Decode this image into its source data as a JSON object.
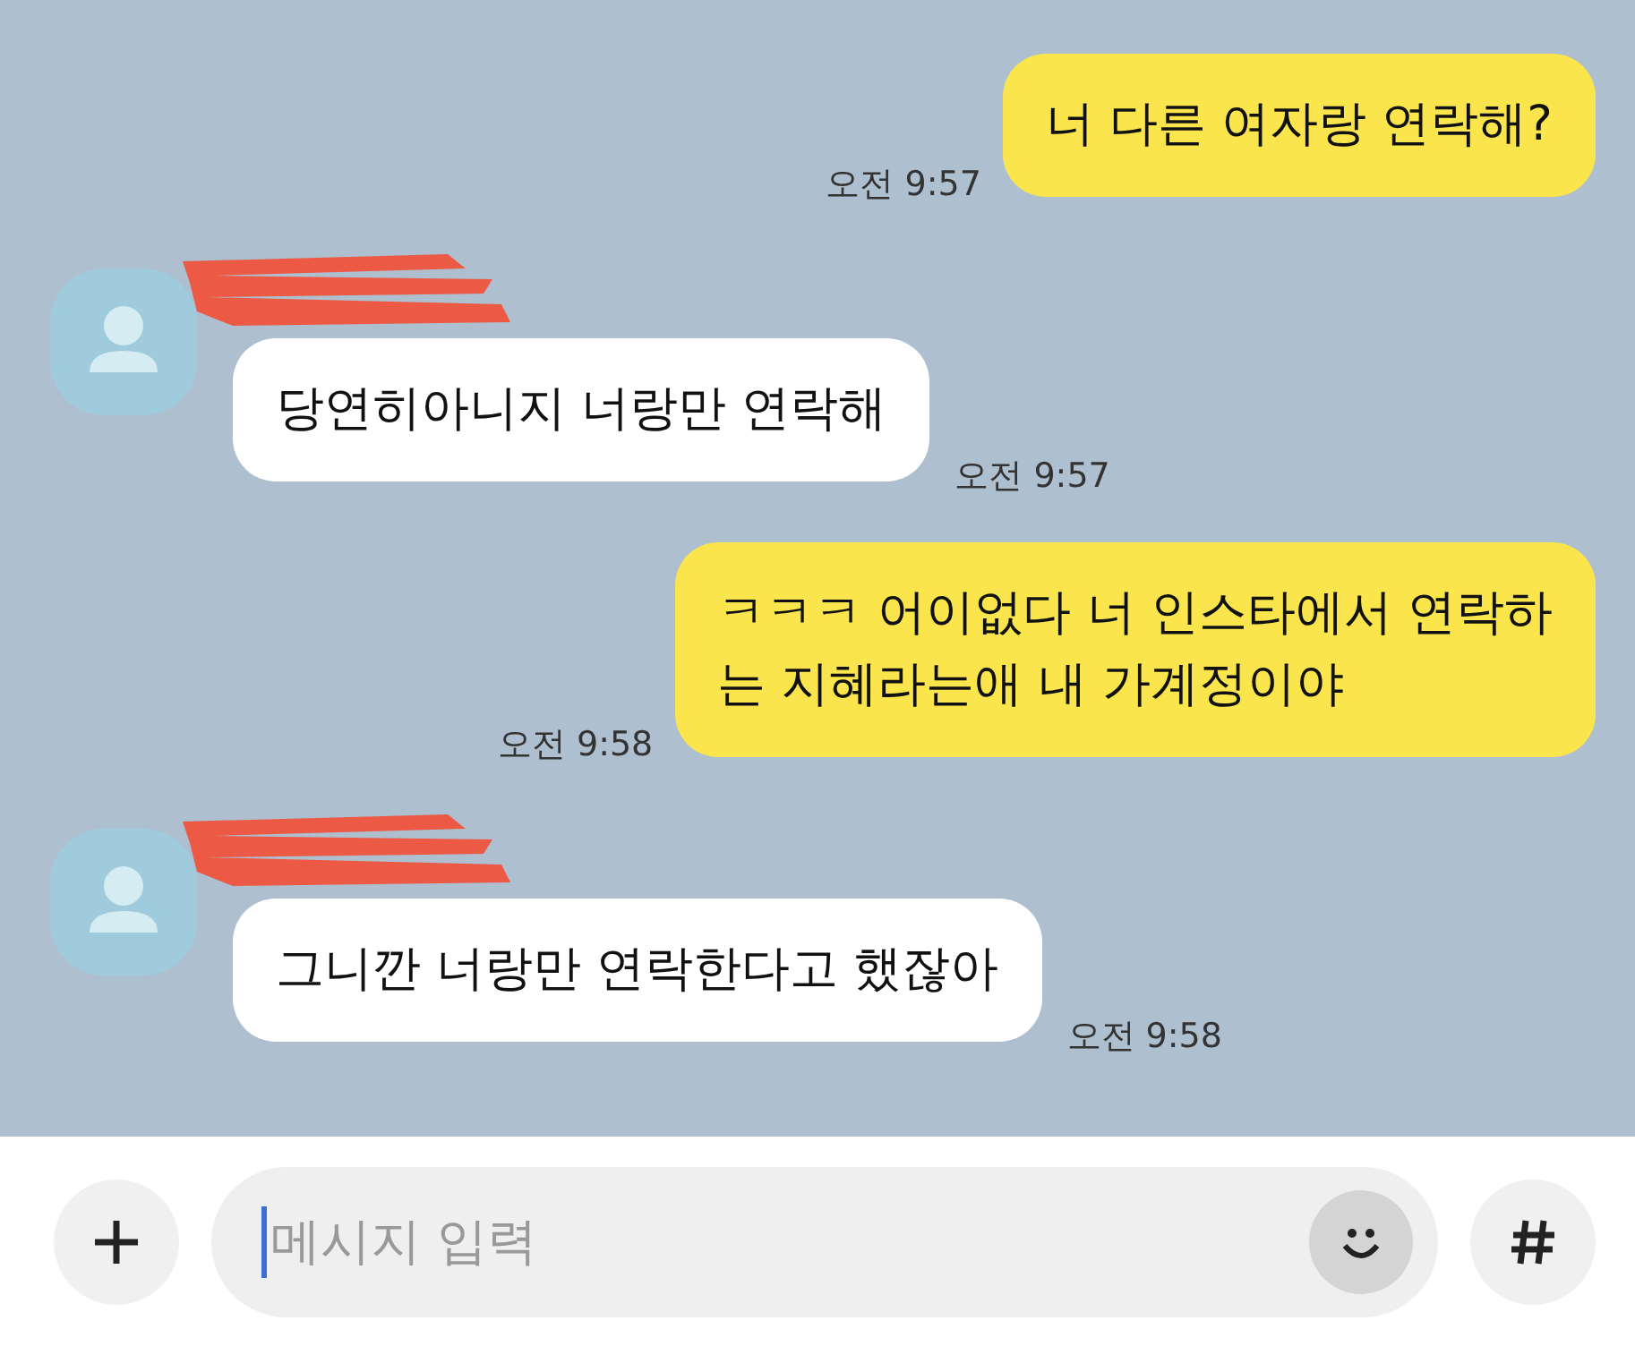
{
  "messages": [
    {
      "kind": "sent",
      "lines": [
        "너 다른 여자랑 연락해?"
      ],
      "time": "오전 9:57"
    },
    {
      "kind": "received",
      "lines": [
        "당연히아니지 너랑만 연락해"
      ],
      "time": "오전 9:57"
    },
    {
      "kind": "sent",
      "lines": [
        "ㅋㅋㅋ 어이없다 너 인스타에서 연락하",
        "는 지혜라는애 내 가계정이야"
      ],
      "time": "오전 9:58"
    },
    {
      "kind": "received",
      "lines": [
        "그니깐 너랑만 연락한다고 했잖아"
      ],
      "time": "오전 9:58"
    }
  ],
  "input": {
    "placeholder": "메시지 입력"
  }
}
